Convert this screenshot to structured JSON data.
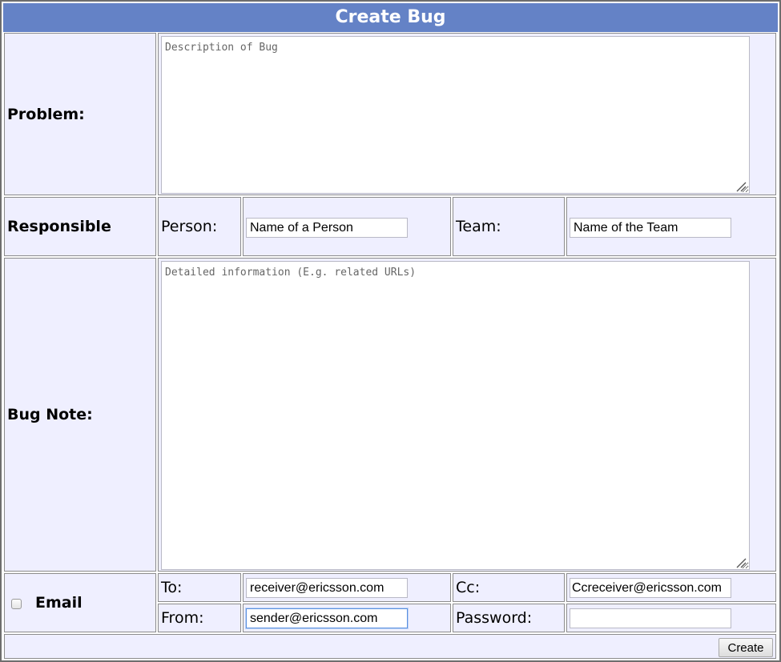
{
  "form": {
    "title": "Create Bug",
    "problem": {
      "label": "Problem:",
      "placeholder": "Description of Bug"
    },
    "responsible": {
      "label": "Responsible",
      "person_label": "Person:",
      "person_value": "Name of a Person",
      "team_label": "Team:",
      "team_value": "Name of the Team"
    },
    "bug_note": {
      "label": "Bug Note:",
      "placeholder": "Detailed information (E.g. related URLs)"
    },
    "email": {
      "label": "Email",
      "checked": false,
      "to_label": "To:",
      "to_value": "receiver@ericsson.com",
      "cc_label": "Cc:",
      "cc_value": "Ccreceiver@ericsson.com",
      "from_label": "From:",
      "from_value": "sender@ericsson.com",
      "password_label": "Password:",
      "password_value": ""
    },
    "create_button_label": "Create"
  },
  "colors": {
    "header_bg": "#6482c6",
    "cell_bg": "#efefff",
    "border": "#8c8c8c"
  }
}
